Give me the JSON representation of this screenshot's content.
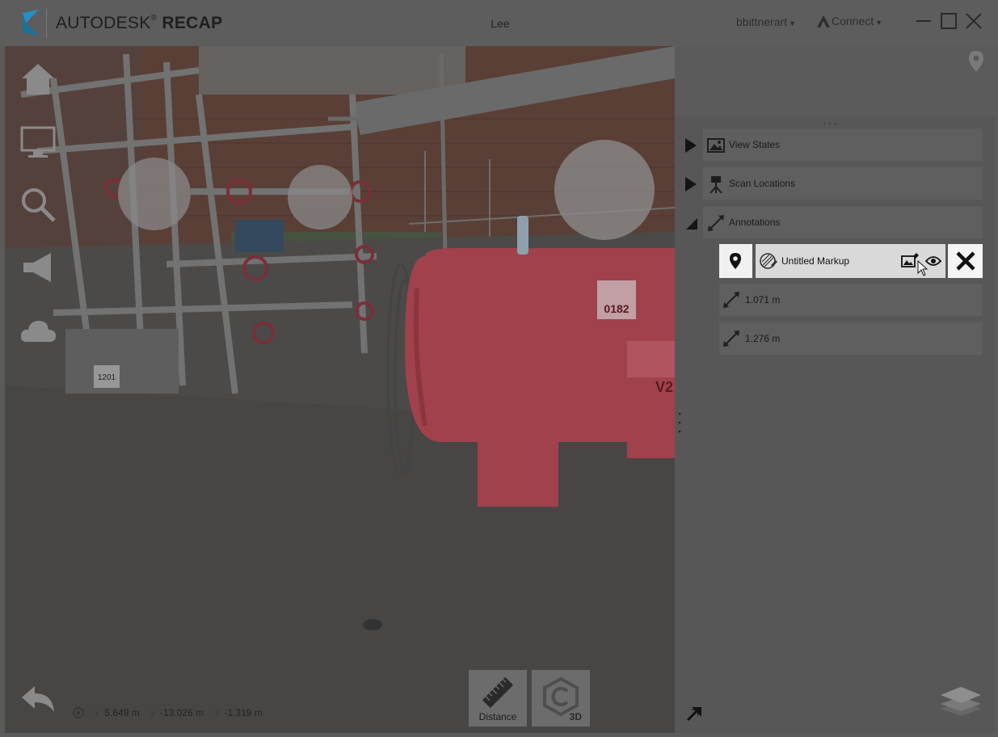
{
  "app": {
    "brand_name": "AUTODESK",
    "brand_product": "RECAP",
    "window_title": "Lee",
    "user_name": "bbittnerart",
    "connect_label": "Connect"
  },
  "viewport": {
    "coords": {
      "x_label": "x",
      "x_value": "5.649",
      "x_unit": "m",
      "y_label": "y",
      "y_value": "-13.026",
      "y_unit": "m",
      "z_label": "z",
      "z_value": "-1.319",
      "z_unit": "m"
    },
    "bottom_buttons": {
      "distance_label": "Distance",
      "mode_label": "3D"
    },
    "scene_labels": {
      "tank_tag": "0182",
      "tank_code": "V2",
      "pump_tag": "1201"
    }
  },
  "panel": {
    "sections": [
      {
        "title": "View States",
        "expanded": false
      },
      {
        "title": "Scan Locations",
        "expanded": false
      },
      {
        "title": "Annotations",
        "expanded": true
      }
    ],
    "markup": {
      "title": "Untitled Markup"
    },
    "measurements": [
      "1.071 m",
      "1.276 m"
    ]
  },
  "colors": {
    "accent_blue": "#0696d7",
    "highlight_red": "#c8424e",
    "overlay": "#5a5a5a"
  },
  "icons": [
    "autodesk-logo-icon",
    "home-icon",
    "monitor-icon",
    "search-icon",
    "megaphone-icon",
    "cloud-icon",
    "back-arrow-icon",
    "map-pin-icon",
    "ruler-icon",
    "cube-3d-icon",
    "image-icon",
    "camera-tripod-icon",
    "measure-icon",
    "markup-icon",
    "edit-image-icon",
    "eye-icon",
    "close-icon",
    "expand-corner-icon",
    "layers-icon"
  ]
}
